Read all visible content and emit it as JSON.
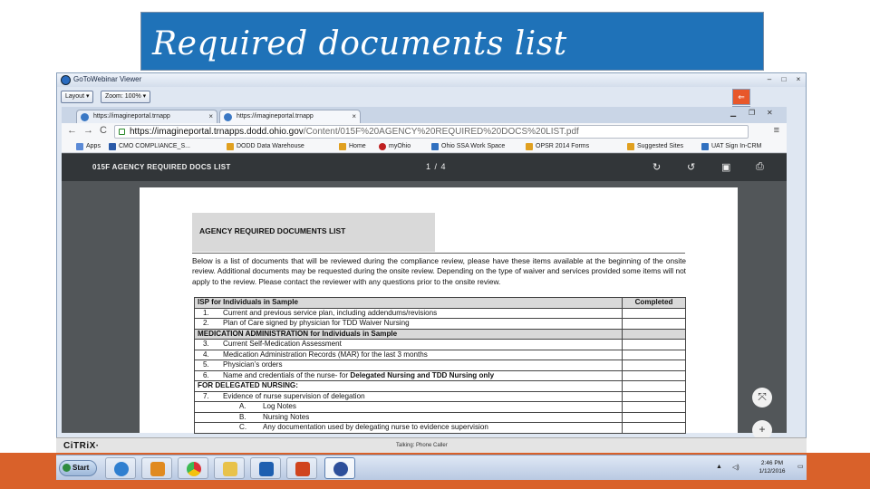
{
  "slide": {
    "title": "Required documents list",
    "colors": {
      "title_bg": "#1f72b8",
      "accent_band": "#d9612a"
    }
  },
  "gotowebinar": {
    "title": "GoToWebinar Viewer",
    "layout_label": "Layout ▾",
    "zoom_label": "Zoom: 100% ▾",
    "win_controls": [
      "‒",
      "□",
      "×"
    ]
  },
  "browser": {
    "tabs": [
      {
        "label": "https://imagineportal.trnapp",
        "active": false
      },
      {
        "label": "https://imagineportal.trnapp",
        "active": true
      }
    ],
    "url_host": "https://imagineportal.trnapps.dodd.ohio.gov",
    "url_path": "/Content/015F%20AGENCY%20REQUIRED%20DOCS%20LIST.pdf",
    "bookmarks": [
      {
        "label": "Apps",
        "color": "#5b8ad6"
      },
      {
        "label": "CMO COMPLIANCE_S...",
        "color": "#2a5aa8"
      },
      {
        "label": "DODD Data Warehouse",
        "color": "#e0a020"
      },
      {
        "label": "Home",
        "color": "#e0a020"
      },
      {
        "label": "myOhio",
        "color": "#c02020"
      },
      {
        "label": "Ohio SSA Work Space",
        "color": "#3070c0"
      },
      {
        "label": "OPSR 2014 Forms",
        "color": "#e0a020"
      },
      {
        "label": "Suggested Sites",
        "color": "#e0a020"
      },
      {
        "label": "UAT Sign In-CRM",
        "color": "#3070c0"
      }
    ]
  },
  "pdf": {
    "filename": "015F AGENCY REQUIRED DOCS LIST",
    "page_indicator": "1 / 4",
    "heading": "AGENCY REQUIRED DOCUMENTS LIST",
    "intro": "Below is a list of documents that will be reviewed during the compliance review, please have these items available at the beginning of the onsite review. Additional documents may be requested during the onsite review.  Depending on the type of waiver and services provided some items will not apply to the review.  Please contact the reviewer with any questions prior to the onsite review.",
    "table": {
      "completed_header": "Completed",
      "rows": [
        {
          "type": "section",
          "text": "ISP for Individuals in Sample",
          "completed": "Completed"
        },
        {
          "type": "item",
          "num": "1.",
          "text": "Current and previous service plan, including addendums/revisions"
        },
        {
          "type": "item",
          "num": "2.",
          "text": "Plan of Care signed by physician for TDD Waiver Nursing"
        },
        {
          "type": "section",
          "text": "MEDICATION ADMINISTRATION for Individuals in Sample",
          "completed": ""
        },
        {
          "type": "item",
          "num": "3.",
          "text": "Current Self-Medication Assessment"
        },
        {
          "type": "item",
          "num": "4.",
          "text": "Medication Administration Records (MAR) for the last 3 months"
        },
        {
          "type": "item",
          "num": "5.",
          "text": "Physician’s orders"
        },
        {
          "type": "item",
          "num": "6.",
          "text": "Name and credentials of the nurse- for ",
          "bold": "Delegated Nursing and TDD Nursing only"
        },
        {
          "type": "plainbold",
          "text": "FOR DELEGATED NURSING:"
        },
        {
          "type": "item",
          "num": "7.",
          "text": "Evidence of nurse supervision of delegation"
        },
        {
          "type": "sub",
          "num": "A.",
          "text": "Log Notes"
        },
        {
          "type": "sub",
          "num": "B.",
          "text": "Nursing Notes"
        },
        {
          "type": "sub",
          "num": "C.",
          "text": "Any documentation used by delegating nurse to evidence supervision"
        }
      ]
    }
  },
  "citrix": {
    "logo": "CiTRiX·",
    "status": "Talking: Phone Caller"
  },
  "taskbar": {
    "start_label": "Start",
    "apps": [
      {
        "name": "internet-explorer",
        "color": "#2f7fd0"
      },
      {
        "name": "media-player",
        "color": "#e08a20"
      },
      {
        "name": "chrome",
        "color": "#3aa33a"
      },
      {
        "name": "file-explorer",
        "color": "#e8c24a"
      },
      {
        "name": "outlook",
        "color": "#1e5fb0"
      },
      {
        "name": "powerpoint",
        "color": "#d0441e"
      },
      {
        "name": "gotowebinar",
        "color": "#2d4f9a"
      }
    ],
    "time": "2:46 PM",
    "date": "1/12/2016"
  }
}
